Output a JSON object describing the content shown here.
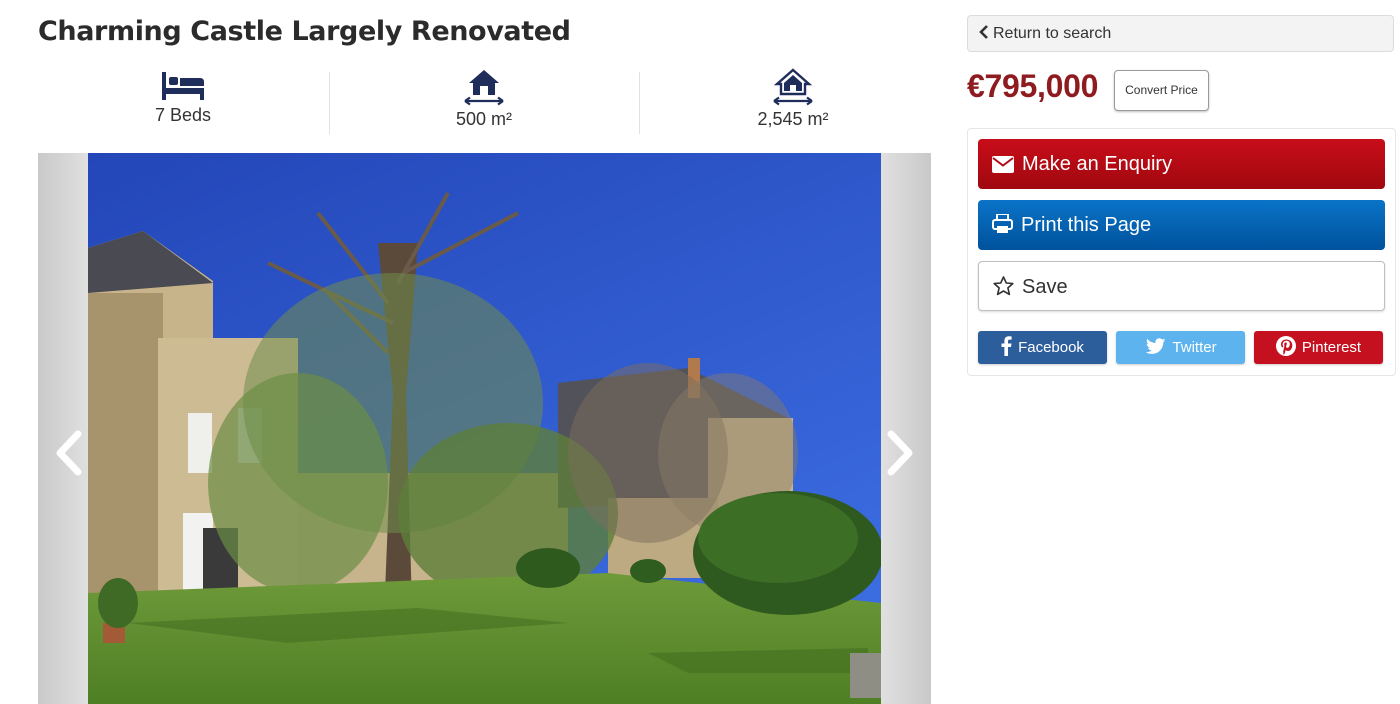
{
  "listing": {
    "title": "Charming Castle Largely Renovated",
    "features": [
      {
        "icon": "bed-icon",
        "label": "7 Beds"
      },
      {
        "icon": "house-area-icon",
        "label": "500 m²"
      },
      {
        "icon": "land-area-icon",
        "label": "2,545 m²"
      }
    ]
  },
  "gallery": {
    "prev_icon": "chevron-left-icon",
    "next_icon": "chevron-right-icon"
  },
  "sidebar": {
    "back_label": "Return to search",
    "price": "€795,000",
    "convert_label": "Convert Price",
    "actions": {
      "enquiry": "Make an Enquiry",
      "print": "Print this Page",
      "save": "Save"
    },
    "social": {
      "facebook": "Facebook",
      "twitter": "Twitter",
      "pinterest": "Pinterest"
    }
  },
  "colors": {
    "price": "#8e1b1f",
    "enquiry": "#b50a15",
    "print": "#0063b1",
    "facebook": "#2d5e9c",
    "twitter": "#5cb3ed",
    "pinterest": "#c5111f",
    "icon": "#1f2d5a"
  }
}
